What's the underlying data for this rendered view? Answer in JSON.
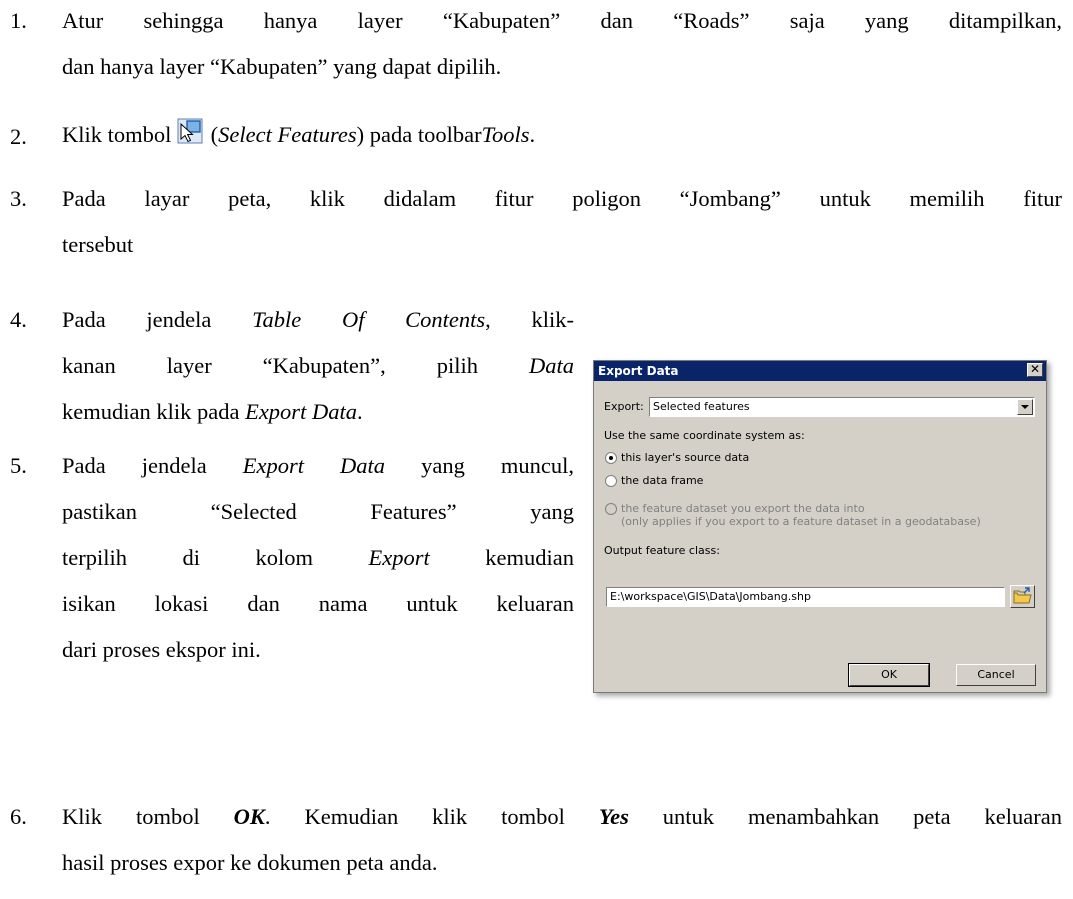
{
  "document": {
    "steps": [
      {
        "number": "1.",
        "line1": "Atur sehingga hanya layer “Kabupaten” dan “Roads” saja yang ditampilkan,",
        "line2": "dan hanya layer “Kabupaten” yang dapat dipilih."
      },
      {
        "number": "2.",
        "pre": "Klik tombol ",
        "icon": "select-features-icon",
        "mid": " (",
        "italic": "Select Features",
        "post": ") pada toolbar",
        "italic2": "Tools",
        "end": "."
      },
      {
        "number": "3.",
        "line1": "Pada layar peta, klik didalam fitur poligon “Jombang” untuk memilih fitur",
        "line2": "tersebut"
      },
      {
        "number": "4.",
        "l1_pre": "Pada jendela ",
        "l1_italic": "Table Of Contents",
        "l1_post": ", klik-",
        "l2_pre": "kanan layer “Kabupaten”, pilih ",
        "l2_italic": "Data",
        "l3_pre": "kemudian klik pada ",
        "l3_italic": "Export Data",
        "l3_post": "."
      },
      {
        "number": "5.",
        "l1_pre": "Pada jendela ",
        "l1_italic": "Export Data",
        "l1_post": " yang muncul,",
        "l2": "pastikan “Selected Features” yang",
        "l3_pre": "terpilih di kolom ",
        "l3_italic": "Export",
        "l3_post": " kemudian",
        "l4": "isikan lokasi dan nama untuk keluaran",
        "l5": "dari proses ekspor ini."
      },
      {
        "number": "6.",
        "l1_pre": "Klik tombol ",
        "l1_bold": "OK",
        "l1_mid": ". Kemudian klik tombol ",
        "l1_bold2": "Yes",
        "l1_post": " untuk menambahkan peta keluaran",
        "l2": "hasil proses expor ke dokumen peta anda."
      }
    ]
  },
  "dialog": {
    "title": "Export Data",
    "close_glyph": "✕",
    "export_label": "Export:",
    "export_value": "Selected features",
    "coord_label": "Use the same coordinate system as:",
    "radio1": "this layer's source data",
    "radio2": "the data frame",
    "radio3_line1": "the feature dataset you export the data into",
    "radio3_line2": "(only applies if you export to a feature dataset in a geodatabase)",
    "output_label": "Output feature class:",
    "output_value": "E:\\workspace\\GIS\\Data\\Jombang.shp",
    "ok_label": "OK",
    "cancel_label": "Cancel",
    "browse_icon": "open-folder-icon",
    "selected_option": "this layer's source data"
  },
  "colors": {
    "dialog_bg": "#d4d0c8",
    "titlebar": "#0a246a",
    "disabled_text": "#808080"
  }
}
